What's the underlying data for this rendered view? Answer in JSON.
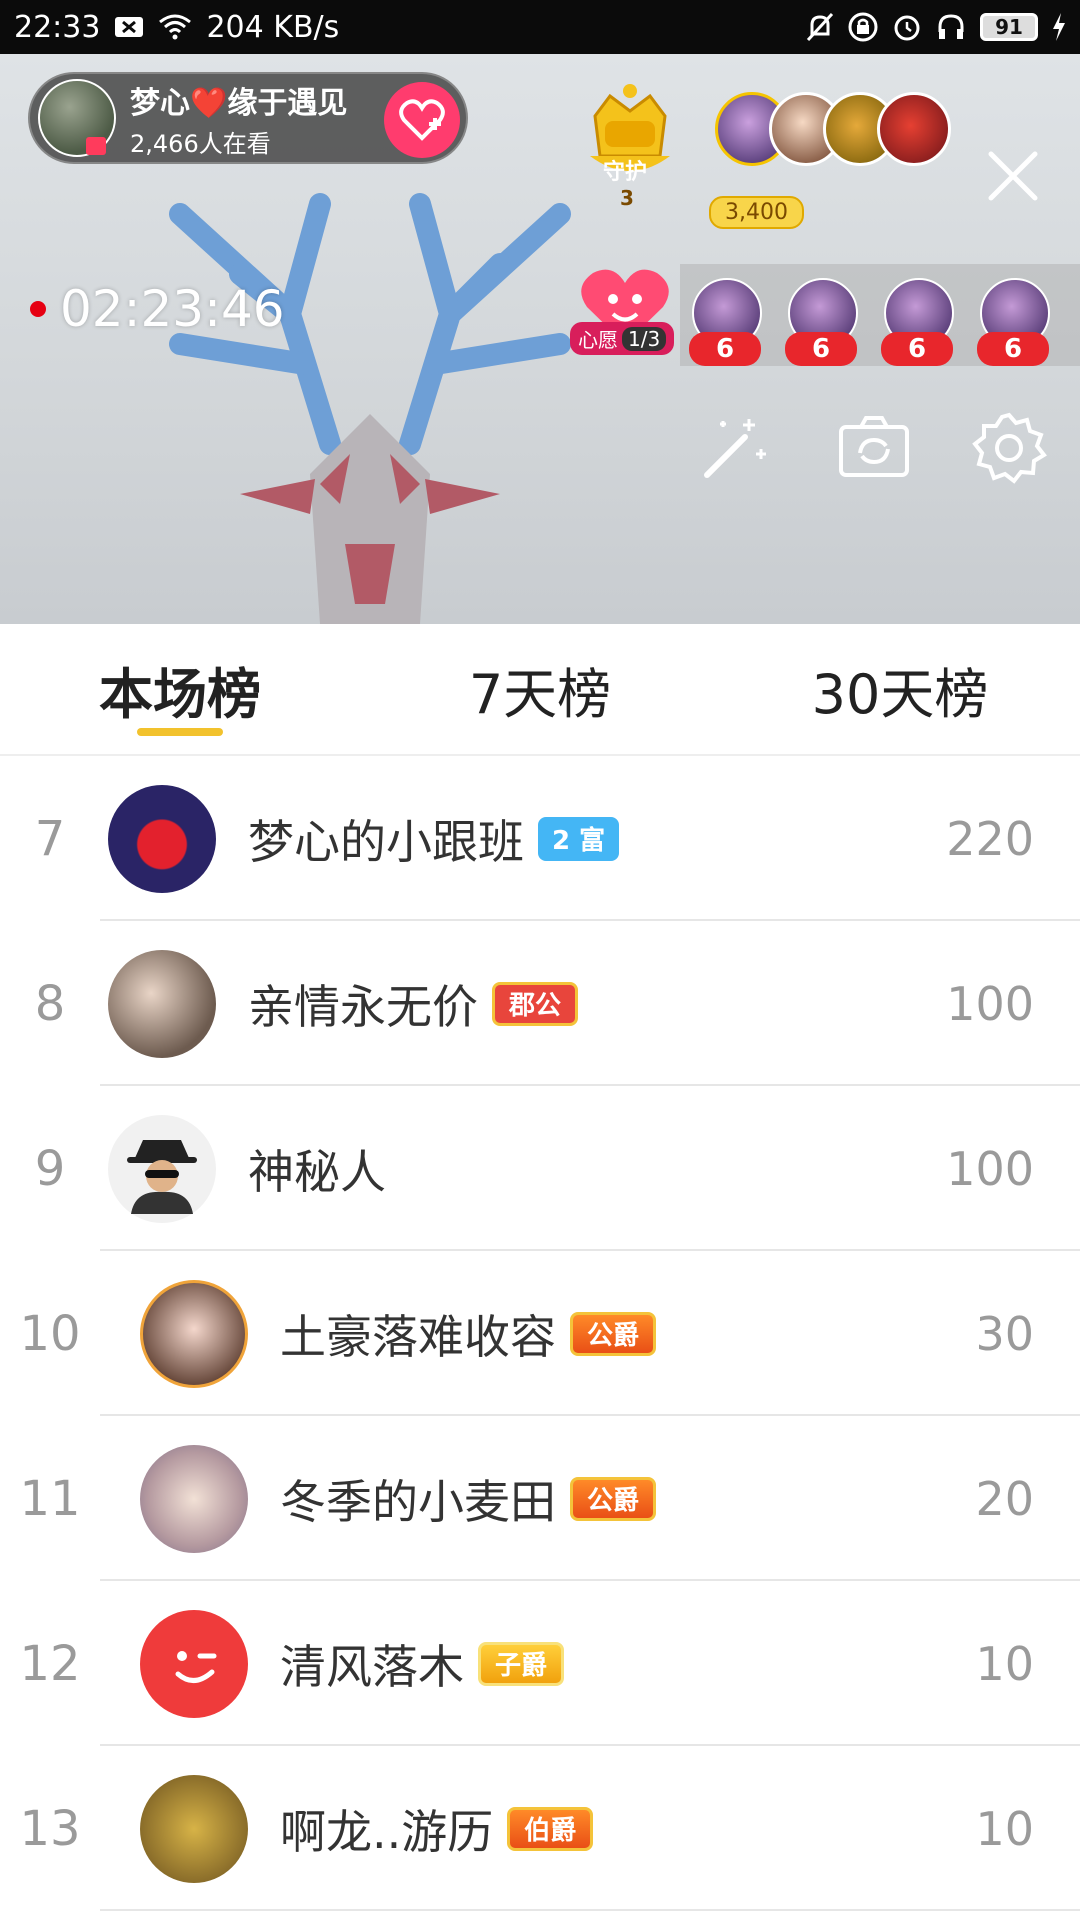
{
  "status_bar": {
    "time": "22:33",
    "speed": "204 KB/s",
    "battery": "91"
  },
  "live": {
    "host_name": "梦心❤️缘于遇见",
    "viewers": "2,466人在看",
    "guard_label": "守护",
    "guard_count": "3",
    "top_score": "3,400",
    "timer": "02:23:46",
    "wish_label": "心愿",
    "wish_progress": "1/3",
    "gift_counts": [
      "6",
      "6",
      "6",
      "6"
    ]
  },
  "tabs": [
    "本场榜",
    "7天榜",
    "30天榜"
  ],
  "active_tab": "本场榜",
  "ranking": [
    {
      "rank": "7",
      "name": "梦心的小跟班",
      "badge": "2 富",
      "badge_style": "blue",
      "score": "220"
    },
    {
      "rank": "8",
      "name": "亲情永无价",
      "badge": "郡公",
      "badge_style": "red",
      "score": "100"
    },
    {
      "rank": "9",
      "name": "神秘人",
      "badge": "",
      "badge_style": "none",
      "score": "100"
    },
    {
      "rank": "10",
      "name": "土豪落难收容",
      "badge": "公爵",
      "badge_style": "orange",
      "score": "30"
    },
    {
      "rank": "11",
      "name": "冬季的小麦田",
      "badge": "公爵",
      "badge_style": "orange",
      "score": "20"
    },
    {
      "rank": "12",
      "name": "清风落木",
      "badge": "子爵",
      "badge_style": "yellow",
      "score": "10"
    },
    {
      "rank": "13",
      "name": "啊龙..游历",
      "badge": "伯爵",
      "badge_style": "orange",
      "score": "10"
    }
  ],
  "colors": {
    "accent_tab_underline": "#f2c22d",
    "follow_button": "#ff3c6e",
    "rank_text": "#9a9a9a"
  }
}
